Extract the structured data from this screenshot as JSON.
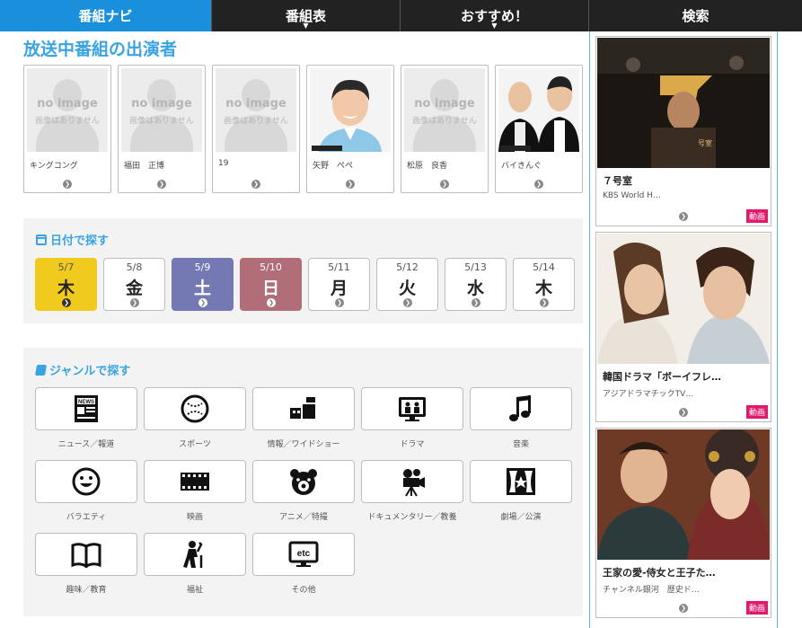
{
  "nav": {
    "items": [
      {
        "label": "番組ナビ"
      },
      {
        "label": "番組表"
      },
      {
        "label": "おすすめ！"
      },
      {
        "label": "検索"
      }
    ]
  },
  "cast": {
    "title": "放送中番組の出演者",
    "noimage_title": "no image",
    "noimage_sub": "画像はありません",
    "people": [
      {
        "name": "キングコング",
        "has_image": false
      },
      {
        "name": "福田　正博",
        "has_image": false
      },
      {
        "name": "19",
        "has_image": false
      },
      {
        "name": "矢野　ぺぺ",
        "has_image": true
      },
      {
        "name": "松原　良香",
        "has_image": false
      },
      {
        "name": "バイきんぐ",
        "has_image": true
      }
    ]
  },
  "date_search": {
    "title": "日付で探す",
    "days": [
      {
        "date": "5/7",
        "weekday": "木",
        "state": "today"
      },
      {
        "date": "5/8",
        "weekday": "金",
        "state": "normal"
      },
      {
        "date": "5/9",
        "weekday": "土",
        "state": "sat"
      },
      {
        "date": "5/10",
        "weekday": "日",
        "state": "sun"
      },
      {
        "date": "5/11",
        "weekday": "月",
        "state": "normal"
      },
      {
        "date": "5/12",
        "weekday": "火",
        "state": "normal"
      },
      {
        "date": "5/13",
        "weekday": "水",
        "state": "normal"
      },
      {
        "date": "5/14",
        "weekday": "木",
        "state": "normal"
      }
    ]
  },
  "genre_search": {
    "title": "ジャンルで探す",
    "genres": [
      {
        "label": "ニュース／報道",
        "icon": "newspaper-icon"
      },
      {
        "label": "スポーツ",
        "icon": "ball-icon"
      },
      {
        "label": "情報／ワイドショー",
        "icon": "info-show-icon"
      },
      {
        "label": "ドラマ",
        "icon": "drama-tv-icon"
      },
      {
        "label": "音楽",
        "icon": "music-note-icon"
      },
      {
        "label": "バラエティ",
        "icon": "smiley-icon"
      },
      {
        "label": "映画",
        "icon": "film-strip-icon"
      },
      {
        "label": "アニメ／特撮",
        "icon": "bear-icon"
      },
      {
        "label": "ドキュメンタリー／教養",
        "icon": "movie-camera-icon"
      },
      {
        "label": "劇場／公演",
        "icon": "stage-icon"
      },
      {
        "label": "趣味／教育",
        "icon": "book-icon"
      },
      {
        "label": "福祉",
        "icon": "welfare-icon"
      },
      {
        "label": "その他",
        "icon": "etc-icon"
      }
    ]
  },
  "sidebar": {
    "cards": [
      {
        "title": "７号室",
        "channel": "KBS World H…",
        "badge": "動画"
      },
      {
        "title": "韓国ドラマ「ボーイフレ…",
        "channel": "アジアドラマチックTV…",
        "badge": "動画"
      },
      {
        "title": "王家の愛-侍女と王子た…",
        "channel": "チャンネル銀河　歴史ド…",
        "badge": "動画"
      }
    ]
  },
  "colors": {
    "accent": "#3aa3e3",
    "nav_active": "#1a8fdc",
    "today": "#f0cb1d",
    "saturday": "#7478b3",
    "sunday": "#b16d78",
    "badge": "#e3186d"
  }
}
